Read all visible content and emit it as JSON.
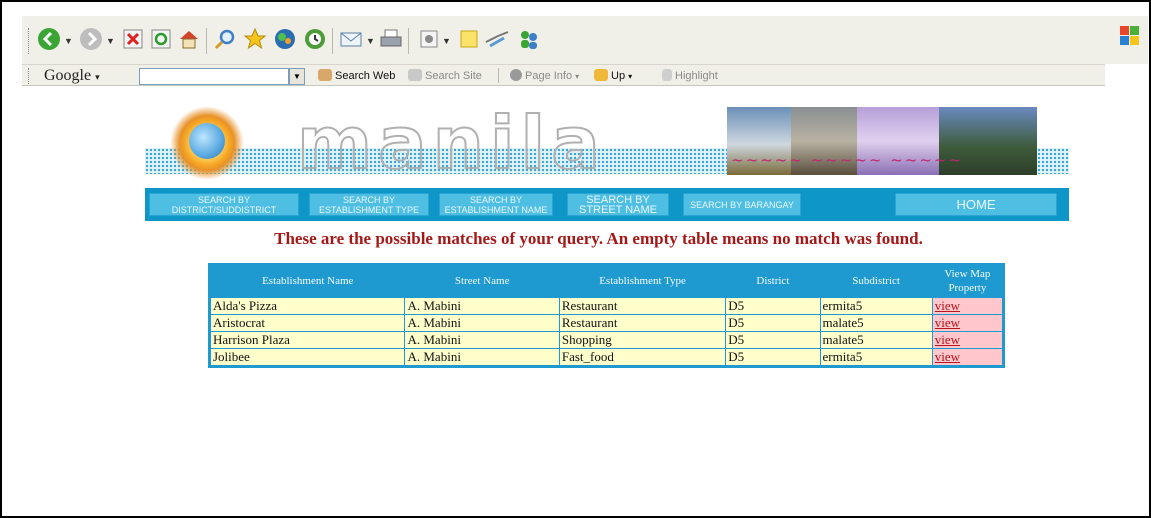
{
  "browser": {
    "toolbar2": {
      "google_label": "Google",
      "search_web": "Search Web",
      "search_site": "Search Site",
      "page_info": "Page Info",
      "up": "Up",
      "highlight": "Highlight"
    }
  },
  "banner": {
    "title": "manila"
  },
  "nav": {
    "items": [
      {
        "line1": "SEARCH BY",
        "line2": "DISTRICT/SUDDISTRICT"
      },
      {
        "line1": "SEARCH BY",
        "line2": "ESTABLISHMENT TYPE"
      },
      {
        "line1": "SEARCH BY",
        "line2": "ESTABLISHMENT NAME"
      },
      {
        "line1": "SEARCH  BY",
        "line2": "STREET NAME"
      },
      {
        "line1": "SEARCH  BY BARANGAY"
      }
    ],
    "home": "HOME"
  },
  "headline": "These are the possible matches of your query. An empty table means no match was found.",
  "table": {
    "headers": [
      "Establishment Name",
      "Street Name",
      "Establishment Type",
      "District",
      "Subdistrict",
      "View Map Property"
    ],
    "rows": [
      {
        "name": "Alda's Pizza",
        "street": "A. Mabini",
        "type": "Restaurant",
        "district": "D5",
        "subdistrict": "ermita5",
        "link": "view"
      },
      {
        "name": "Aristocrat",
        "street": "A. Mabini",
        "type": "Restaurant",
        "district": "D5",
        "subdistrict": "malate5",
        "link": "view"
      },
      {
        "name": "Harrison Plaza",
        "street": "A. Mabini",
        "type": "Shopping",
        "district": "D5",
        "subdistrict": "malate5",
        "link": "view"
      },
      {
        "name": "Jolibee",
        "street": "A. Mabini",
        "type": "Fast_food",
        "district": "D5",
        "subdistrict": "ermita5",
        "link": "view"
      }
    ]
  }
}
